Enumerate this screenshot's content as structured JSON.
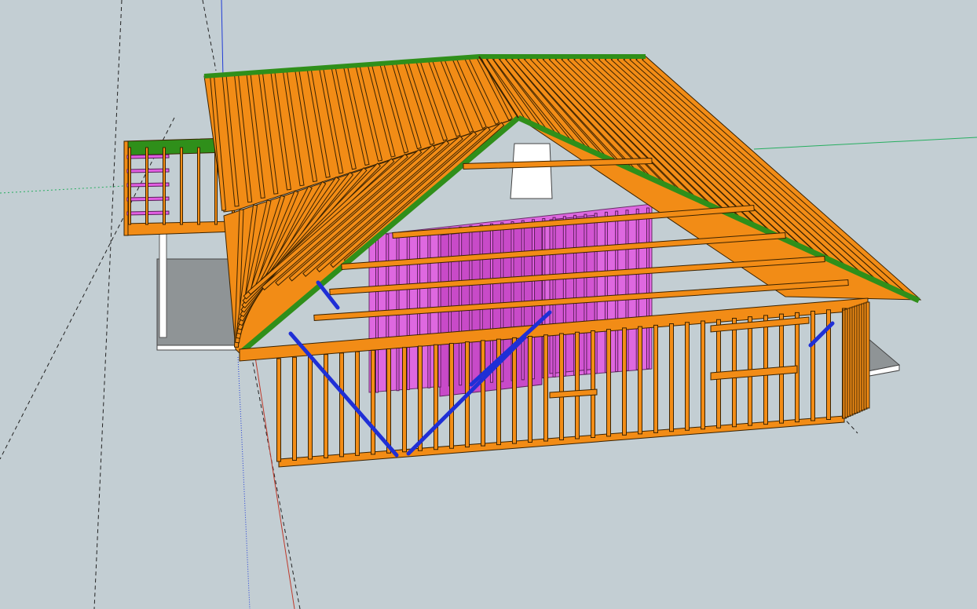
{
  "viewport": {
    "background": "#c3ced3",
    "ground_color": "#8f9496",
    "model": "house-framing"
  },
  "colors": {
    "roof_framing": "#f28c16",
    "roof_edge": "#2f8f1a",
    "interior_walls": "#e25de2",
    "bracing": "#1f2fd6",
    "axis_red": "#c0392b",
    "axis_green": "#27ae60",
    "axis_blue": "#1f3bd6",
    "guide_line": "#222222"
  }
}
